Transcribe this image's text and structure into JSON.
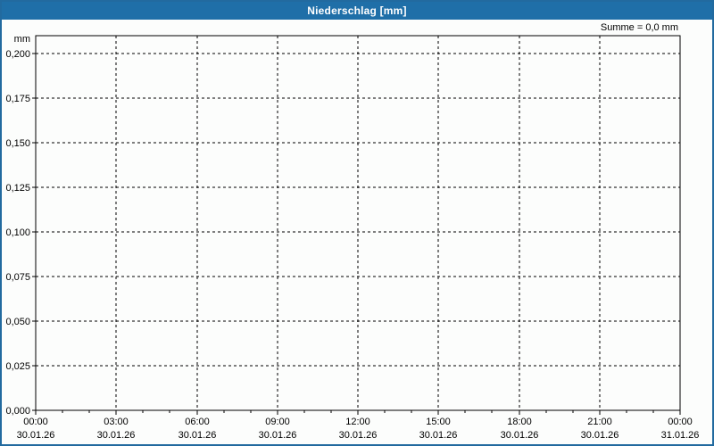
{
  "window": {
    "title": "Niederschlag [mm]",
    "summary": "Summe = 0,0 mm"
  },
  "colors": {
    "titlebar_bg": "#1f6fa8",
    "frame_border": "#226a9f",
    "background": "#fcfdfc",
    "grid": "#000000",
    "axis": "#000000",
    "text": "#000000",
    "title_text": "#ffffff"
  },
  "chart_data": {
    "type": "line",
    "title": "Niederschlag [mm]",
    "ylabel": "mm",
    "xlabel": "",
    "ylim": [
      0,
      0.21
    ],
    "grid": "dashed",
    "legend_position": "none",
    "annotation": "Summe = 0,0 mm",
    "y_ticks": [
      {
        "value": 0.0,
        "label": "0,000"
      },
      {
        "value": 0.025,
        "label": "0,025"
      },
      {
        "value": 0.05,
        "label": "0,050"
      },
      {
        "value": 0.075,
        "label": "0,075"
      },
      {
        "value": 0.1,
        "label": "0,100"
      },
      {
        "value": 0.125,
        "label": "0,125"
      },
      {
        "value": 0.15,
        "label": "0,150"
      },
      {
        "value": 0.175,
        "label": "0,175"
      },
      {
        "value": 0.2,
        "label": "0,200"
      }
    ],
    "x_range_hours": [
      0,
      24
    ],
    "x_minor_tick_interval_hours": 1,
    "x_ticks": [
      {
        "hour": 0,
        "time": "00:00",
        "date": "30.01.26"
      },
      {
        "hour": 3,
        "time": "03:00",
        "date": "30.01.26"
      },
      {
        "hour": 6,
        "time": "06:00",
        "date": "30.01.26"
      },
      {
        "hour": 9,
        "time": "09:00",
        "date": "30.01.26"
      },
      {
        "hour": 12,
        "time": "12:00",
        "date": "30.01.26"
      },
      {
        "hour": 15,
        "time": "15:00",
        "date": "30.01.26"
      },
      {
        "hour": 18,
        "time": "18:00",
        "date": "30.01.26"
      },
      {
        "hour": 21,
        "time": "21:00",
        "date": "30.01.26"
      },
      {
        "hour": 24,
        "time": "00:00",
        "date": "31.01.26"
      }
    ],
    "series": [
      {
        "name": "Niederschlag",
        "unit": "mm",
        "points": [],
        "sum": 0.0
      }
    ]
  }
}
